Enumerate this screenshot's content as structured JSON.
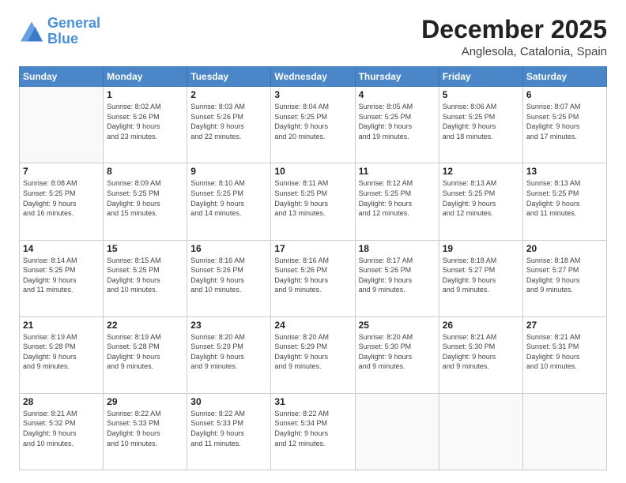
{
  "header": {
    "logo_line1": "General",
    "logo_line2": "Blue",
    "month": "December 2025",
    "location": "Anglesola, Catalonia, Spain"
  },
  "weekdays": [
    "Sunday",
    "Monday",
    "Tuesday",
    "Wednesday",
    "Thursday",
    "Friday",
    "Saturday"
  ],
  "weeks": [
    [
      {
        "day": "",
        "info": ""
      },
      {
        "day": "1",
        "info": "Sunrise: 8:02 AM\nSunset: 5:26 PM\nDaylight: 9 hours\nand 23 minutes."
      },
      {
        "day": "2",
        "info": "Sunrise: 8:03 AM\nSunset: 5:26 PM\nDaylight: 9 hours\nand 22 minutes."
      },
      {
        "day": "3",
        "info": "Sunrise: 8:04 AM\nSunset: 5:25 PM\nDaylight: 9 hours\nand 20 minutes."
      },
      {
        "day": "4",
        "info": "Sunrise: 8:05 AM\nSunset: 5:25 PM\nDaylight: 9 hours\nand 19 minutes."
      },
      {
        "day": "5",
        "info": "Sunrise: 8:06 AM\nSunset: 5:25 PM\nDaylight: 9 hours\nand 18 minutes."
      },
      {
        "day": "6",
        "info": "Sunrise: 8:07 AM\nSunset: 5:25 PM\nDaylight: 9 hours\nand 17 minutes."
      }
    ],
    [
      {
        "day": "7",
        "info": "Sunrise: 8:08 AM\nSunset: 5:25 PM\nDaylight: 9 hours\nand 16 minutes."
      },
      {
        "day": "8",
        "info": "Sunrise: 8:09 AM\nSunset: 5:25 PM\nDaylight: 9 hours\nand 15 minutes."
      },
      {
        "day": "9",
        "info": "Sunrise: 8:10 AM\nSunset: 5:25 PM\nDaylight: 9 hours\nand 14 minutes."
      },
      {
        "day": "10",
        "info": "Sunrise: 8:11 AM\nSunset: 5:25 PM\nDaylight: 9 hours\nand 13 minutes."
      },
      {
        "day": "11",
        "info": "Sunrise: 8:12 AM\nSunset: 5:25 PM\nDaylight: 9 hours\nand 12 minutes."
      },
      {
        "day": "12",
        "info": "Sunrise: 8:13 AM\nSunset: 5:25 PM\nDaylight: 9 hours\nand 12 minutes."
      },
      {
        "day": "13",
        "info": "Sunrise: 8:13 AM\nSunset: 5:25 PM\nDaylight: 9 hours\nand 11 minutes."
      }
    ],
    [
      {
        "day": "14",
        "info": "Sunrise: 8:14 AM\nSunset: 5:25 PM\nDaylight: 9 hours\nand 11 minutes."
      },
      {
        "day": "15",
        "info": "Sunrise: 8:15 AM\nSunset: 5:25 PM\nDaylight: 9 hours\nand 10 minutes."
      },
      {
        "day": "16",
        "info": "Sunrise: 8:16 AM\nSunset: 5:26 PM\nDaylight: 9 hours\nand 10 minutes."
      },
      {
        "day": "17",
        "info": "Sunrise: 8:16 AM\nSunset: 5:26 PM\nDaylight: 9 hours\nand 9 minutes."
      },
      {
        "day": "18",
        "info": "Sunrise: 8:17 AM\nSunset: 5:26 PM\nDaylight: 9 hours\nand 9 minutes."
      },
      {
        "day": "19",
        "info": "Sunrise: 8:18 AM\nSunset: 5:27 PM\nDaylight: 9 hours\nand 9 minutes."
      },
      {
        "day": "20",
        "info": "Sunrise: 8:18 AM\nSunset: 5:27 PM\nDaylight: 9 hours\nand 9 minutes."
      }
    ],
    [
      {
        "day": "21",
        "info": "Sunrise: 8:19 AM\nSunset: 5:28 PM\nDaylight: 9 hours\nand 9 minutes."
      },
      {
        "day": "22",
        "info": "Sunrise: 8:19 AM\nSunset: 5:28 PM\nDaylight: 9 hours\nand 9 minutes."
      },
      {
        "day": "23",
        "info": "Sunrise: 8:20 AM\nSunset: 5:29 PM\nDaylight: 9 hours\nand 9 minutes."
      },
      {
        "day": "24",
        "info": "Sunrise: 8:20 AM\nSunset: 5:29 PM\nDaylight: 9 hours\nand 9 minutes."
      },
      {
        "day": "25",
        "info": "Sunrise: 8:20 AM\nSunset: 5:30 PM\nDaylight: 9 hours\nand 9 minutes."
      },
      {
        "day": "26",
        "info": "Sunrise: 8:21 AM\nSunset: 5:30 PM\nDaylight: 9 hours\nand 9 minutes."
      },
      {
        "day": "27",
        "info": "Sunrise: 8:21 AM\nSunset: 5:31 PM\nDaylight: 9 hours\nand 10 minutes."
      }
    ],
    [
      {
        "day": "28",
        "info": "Sunrise: 8:21 AM\nSunset: 5:32 PM\nDaylight: 9 hours\nand 10 minutes."
      },
      {
        "day": "29",
        "info": "Sunrise: 8:22 AM\nSunset: 5:33 PM\nDaylight: 9 hours\nand 10 minutes."
      },
      {
        "day": "30",
        "info": "Sunrise: 8:22 AM\nSunset: 5:33 PM\nDaylight: 9 hours\nand 11 minutes."
      },
      {
        "day": "31",
        "info": "Sunrise: 8:22 AM\nSunset: 5:34 PM\nDaylight: 9 hours\nand 12 minutes."
      },
      {
        "day": "",
        "info": ""
      },
      {
        "day": "",
        "info": ""
      },
      {
        "day": "",
        "info": ""
      }
    ]
  ]
}
